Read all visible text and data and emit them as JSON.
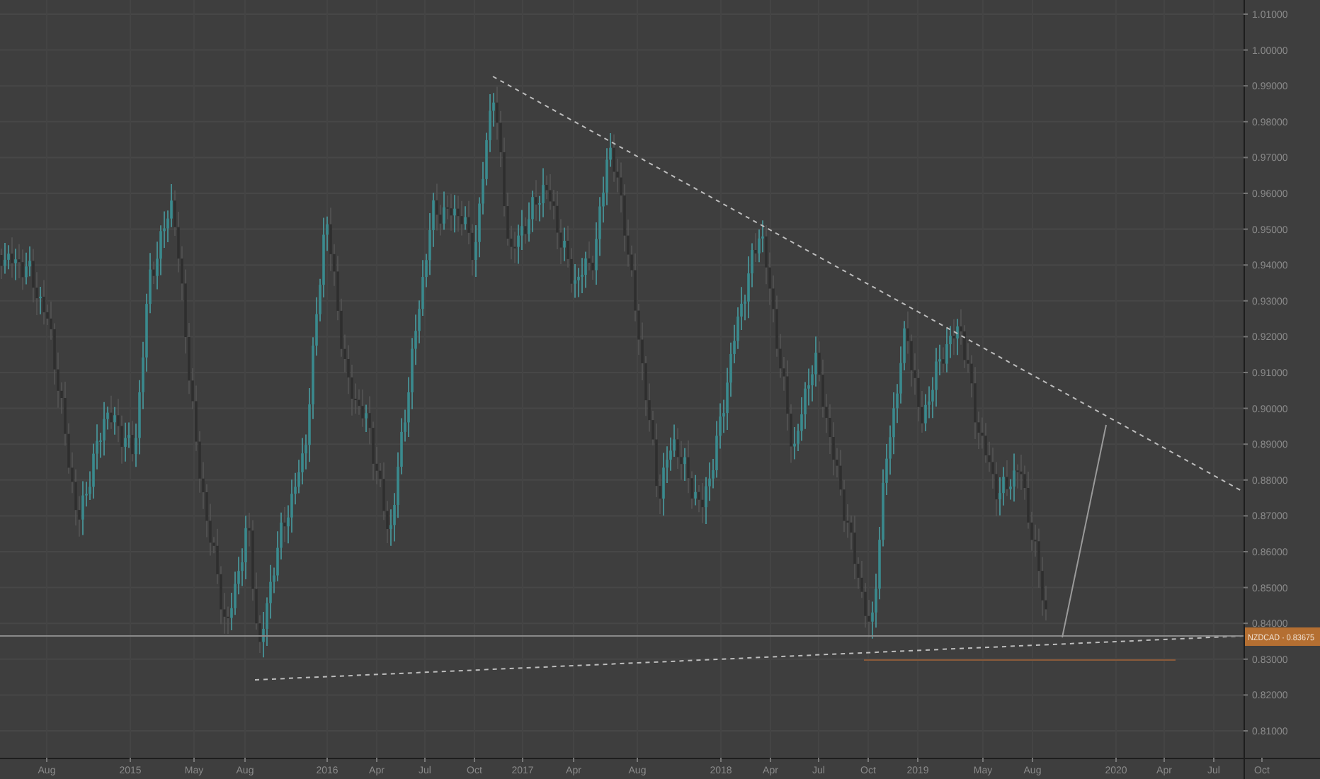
{
  "price_axis": {
    "ticks": [
      "1.01000",
      "1.00000",
      "0.99000",
      "0.98000",
      "0.97000",
      "0.96000",
      "0.95000",
      "0.94000",
      "0.93000",
      "0.92000",
      "0.91000",
      "0.90000",
      "0.89000",
      "0.88000",
      "0.87000",
      "0.86000",
      "0.85000",
      "0.84000",
      "0.83000",
      "0.82000",
      "0.81000"
    ]
  },
  "time_axis": {
    "ticks": [
      "Aug",
      "2015",
      "May",
      "Aug",
      "2016",
      "Apr",
      "Jul",
      "Oct",
      "2017",
      "Apr",
      "Aug",
      "2018",
      "Apr",
      "Jul",
      "Oct",
      "2019",
      "May",
      "Aug",
      "2020",
      "Apr",
      "Jul",
      "Oct"
    ]
  },
  "price_label": {
    "text": "NZDCAD · 0.83675"
  }
}
